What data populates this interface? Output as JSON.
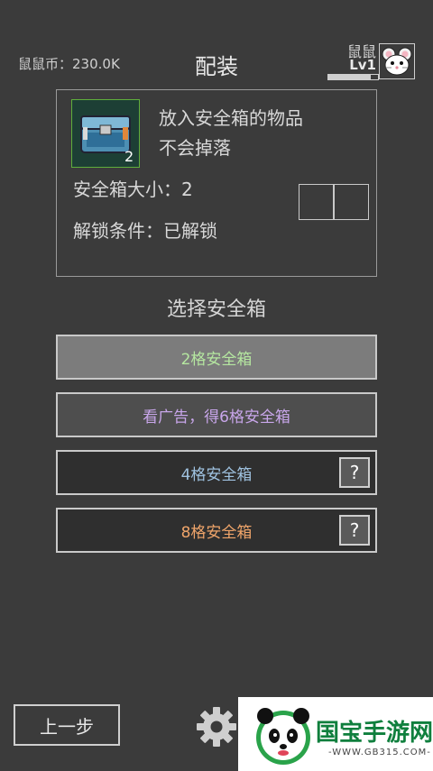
{
  "header": {
    "currency_label": "鼠鼠币：230.0K",
    "title": "配装",
    "user_name": "鼠鼠",
    "user_level": "Lv1",
    "level_progress": 0.85
  },
  "safe_box": {
    "item_count": "2",
    "desc_line1": "放入安全箱的物品",
    "desc_line2": "不会掉落",
    "capacity_label": "安全箱大小：2",
    "unlock_label": "解锁条件：已解锁",
    "slot_count": 2
  },
  "section_title": "选择安全箱",
  "options": [
    {
      "label": "2格安全箱",
      "color": "#b5e7a0"
    },
    {
      "label": "看广告，得6格安全箱",
      "color": "#c8a6ea"
    },
    {
      "label": "4格安全箱",
      "color": "#9fc2e0",
      "help": "?"
    },
    {
      "label": "8格安全箱",
      "color": "#f0a56a",
      "help": "?"
    }
  ],
  "footer": {
    "back_label": "上一步",
    "settings_icon": "gear-icon"
  },
  "watermark": {
    "logo_icon": "panda-logo-icon",
    "text": "国宝手游网",
    "url": "-WWW.GB315.COM-"
  }
}
